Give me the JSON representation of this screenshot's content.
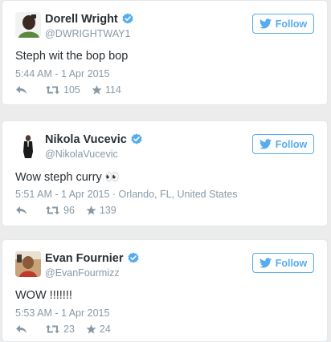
{
  "tweets": [
    {
      "name": "Dorell Wright",
      "handle": "@DWRIGHTWAY1",
      "text": "Steph wit the bop bop",
      "timestamp": "5:44 AM - 1 Apr 2015",
      "retweets": "105",
      "favorites": "114"
    },
    {
      "name": "Nikola Vucevic",
      "handle": "@NikolaVucevic",
      "text": "Wow steph curry 👀",
      "timestamp": "5:51 AM - 1 Apr 2015 · Orlando, FL, United States",
      "retweets": "96",
      "favorites": "139"
    },
    {
      "name": "Evan Fournier",
      "handle": "@EvanFourmizz",
      "text": "WOW !!!!!!!",
      "timestamp": "5:53 AM - 1 Apr 2015",
      "retweets": "23",
      "favorites": "24"
    }
  ],
  "follow_label": "Follow",
  "colors": {
    "accent": "#55acee",
    "muted": "#8899a6",
    "text": "#292f33",
    "verified": "#55acee"
  },
  "icons": [
    "verified-badge-icon",
    "twitter-bird-icon",
    "reply-icon",
    "retweet-icon",
    "favorite-star-icon"
  ]
}
